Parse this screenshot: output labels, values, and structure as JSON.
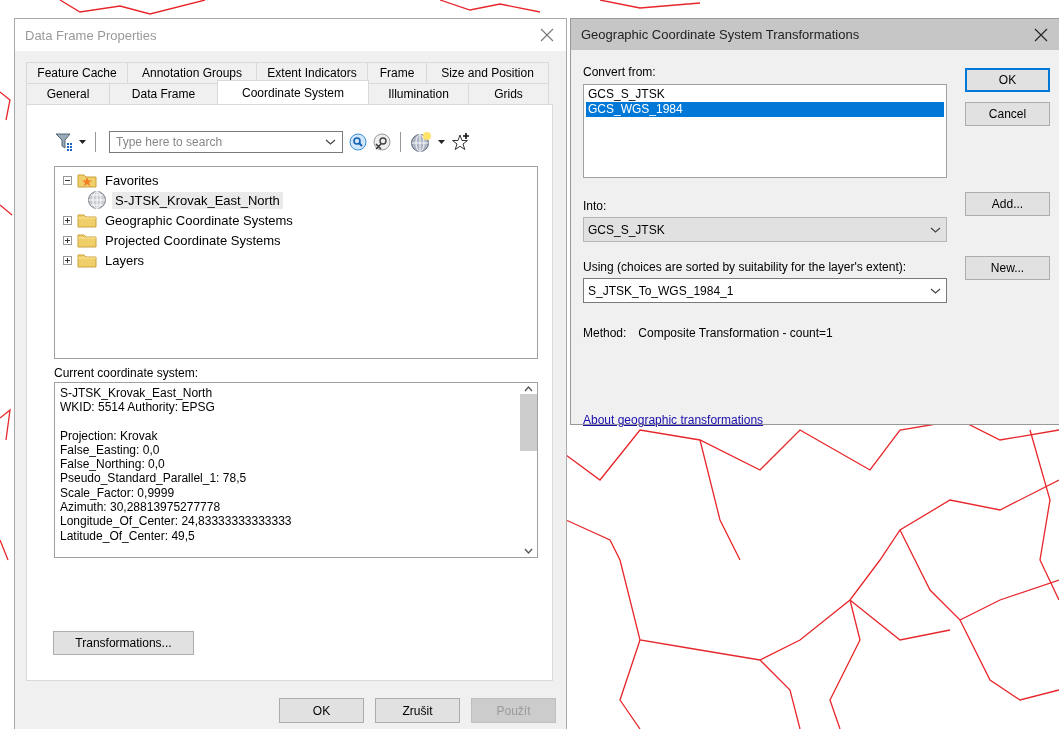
{
  "properties_dialog": {
    "title": "Data Frame Properties",
    "tab_rows": [
      [
        {
          "label": "Feature Cache",
          "selected": false
        },
        {
          "label": "Annotation Groups",
          "selected": false
        },
        {
          "label": "Extent Indicators",
          "selected": false
        },
        {
          "label": "Frame",
          "selected": false
        },
        {
          "label": "Size and Position",
          "selected": false
        }
      ],
      [
        {
          "label": "General",
          "selected": false
        },
        {
          "label": "Data Frame",
          "selected": false
        },
        {
          "label": "Coordinate System",
          "selected": true
        },
        {
          "label": "Illumination",
          "selected": false
        },
        {
          "label": "Grids",
          "selected": false
        }
      ]
    ],
    "search": {
      "placeholder": "Type here to search"
    },
    "tree": [
      {
        "label": "Favorites",
        "kind": "favorites",
        "expanded": true,
        "selected": false,
        "children": [
          {
            "label": "S-JTSK_Krovak_East_North",
            "kind": "globe",
            "selected": true
          }
        ]
      },
      {
        "label": "Geographic Coordinate Systems",
        "kind": "folder",
        "expanded": false,
        "selected": false
      },
      {
        "label": "Projected Coordinate Systems",
        "kind": "folder",
        "expanded": false,
        "selected": false
      },
      {
        "label": "Layers",
        "kind": "folder",
        "expanded": false,
        "selected": false
      }
    ],
    "current_label": "Current coordinate system:",
    "details": [
      [
        "S-JTSK_Krovak_East_North",
        "WKID: 5514 Authority: EPSG"
      ],
      [
        "Projection: Krovak",
        "False_Easting: 0,0",
        "False_Northing: 0,0",
        "Pseudo_Standard_Parallel_1: 78,5",
        "Scale_Factor: 0,9999",
        "Azimuth: 30,28813975277778",
        "Longitude_Of_Center: 24,83333333333333",
        "Latitude_Of_Center: 49,5"
      ]
    ],
    "transformations_button": "Transformations...",
    "buttons": [
      {
        "label": "OK",
        "disabled": false
      },
      {
        "label": "Zrušit",
        "disabled": false
      },
      {
        "label": "Použít",
        "disabled": true
      }
    ]
  },
  "transform_dialog": {
    "title": "Geographic Coordinate System Transformations",
    "convert_from_label": "Convert from:",
    "convert_from": [
      {
        "label": "GCS_S_JTSK",
        "selected": false
      },
      {
        "label": "GCS_WGS_1984",
        "selected": true
      }
    ],
    "into_label": "Into:",
    "into_value": "GCS_S_JTSK",
    "using_label": "Using (choices are sorted by suitability for the layer's extent):",
    "using_value": "S_JTSK_To_WGS_1984_1",
    "method_label": "Method:",
    "method_value": "Composite Transformation - count=1",
    "link": "About geographic transformations",
    "buttons": [
      {
        "label": "OK",
        "default": true
      },
      {
        "label": "Cancel",
        "default": false
      },
      {
        "label": "Add...",
        "default": false
      },
      {
        "label": "New...",
        "default": false
      }
    ]
  }
}
